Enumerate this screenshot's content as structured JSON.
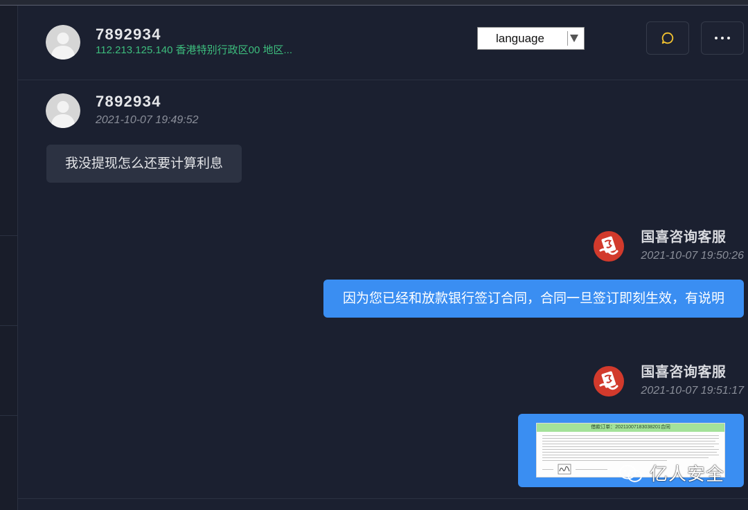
{
  "colors": {
    "background": "#1b2030",
    "accent": "#3a8ef2",
    "location_green": "#3dbd7d",
    "brand_red": "#d23a2c",
    "chat_icon_yellow": "#f2c230"
  },
  "header": {
    "avatar_icon": "default-user-avatar-icon",
    "username": "7892934",
    "location": "112.213.125.140 香港特别行政区00 地区...",
    "language_select": {
      "selected": "language",
      "arrow_icon": "triangle-down-icon"
    },
    "chat_button_icon": "chat-bubble-icon",
    "more_button_icon": "more-dots-icon"
  },
  "messages": [
    {
      "sender": "7892934",
      "time": "2021-10-07 19:49:52",
      "avatar_icon": "default-user-avatar-icon",
      "text": "我没提现怎么还要计算利息"
    },
    {
      "sender": "国喜咨询客服",
      "time": "2021-10-07 19:50:26",
      "avatar_icon": "agent-logo-icon",
      "text": "因为您已经和放款银行签订合同，合同一旦签订即刻生效，有说明"
    },
    {
      "sender": "国喜咨询客服",
      "time": "2021-10-07 19:51:17",
      "avatar_icon": "agent-logo-icon",
      "image": {
        "document_title": "借款订单：20211007183038201合同"
      }
    }
  ],
  "watermark": {
    "icon": "wechat-icon",
    "text": "亿人安全"
  }
}
